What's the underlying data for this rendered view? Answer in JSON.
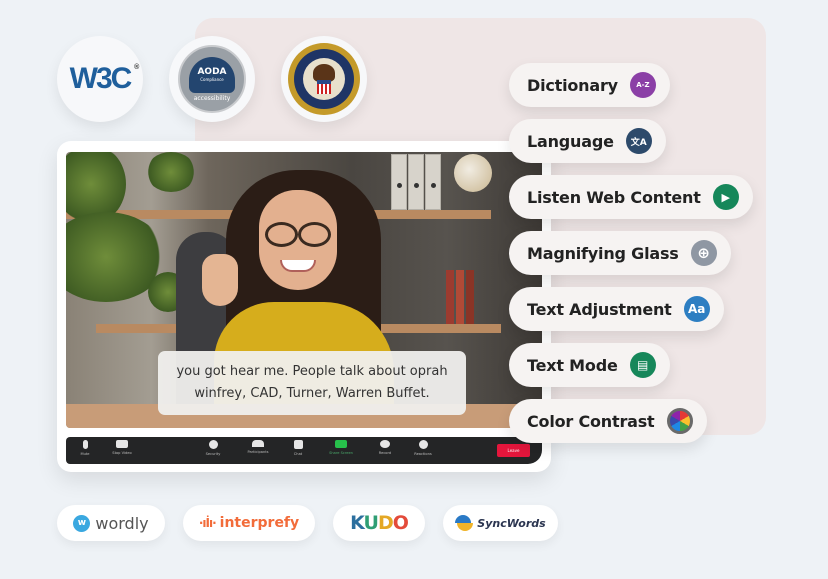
{
  "compliance_badges": [
    {
      "name": "W3C",
      "text": "W3C",
      "mark": "®"
    },
    {
      "name": "AODA",
      "text": "AODA",
      "subtext": "Compliance",
      "bottom": "accessibility"
    },
    {
      "name": "Department of Justice",
      "text": "Department of Justice"
    }
  ],
  "video_call": {
    "caption_line1": "you got hear me. People talk about oprah",
    "caption_line2": "winfrey, CAD, Turner, Warren Buffet.",
    "toolbar": {
      "mute": "Mute",
      "stop_video": "Stop Video",
      "security": "Security",
      "participants": "Participants",
      "chat": "Chat",
      "share_screen": "Share Screen",
      "record": "Record",
      "reactions": "Reactions",
      "leave": "Leave"
    }
  },
  "features": [
    {
      "label": "Dictionary",
      "icon": "book-az-icon",
      "glyph": "A-Z",
      "color": "#8b3fa6"
    },
    {
      "label": "Language",
      "icon": "translate-icon",
      "glyph": "文A",
      "color": "#2d4a6b"
    },
    {
      "label": "Listen Web Content",
      "icon": "play-icon",
      "glyph": "▶",
      "color": "#16875a"
    },
    {
      "label": "Magnifying Glass",
      "icon": "magnifier-icon",
      "glyph": "⊕",
      "color": "#8f97a3"
    },
    {
      "label": "Text Adjustment",
      "icon": "text-size-icon",
      "glyph": "Aa",
      "color": "#2d7ec2"
    },
    {
      "label": "Text Mode",
      "icon": "text-document-icon",
      "glyph": "▤",
      "color": "#16875a"
    },
    {
      "label": "Color Contrast",
      "icon": "color-wheel-icon",
      "glyph": "",
      "color": "#6a6a6a"
    }
  ],
  "partners": {
    "wordly": {
      "badge": "w",
      "text": "wordly"
    },
    "interprefy": {
      "bars": "·ıİı·",
      "text": "interprefy"
    },
    "kudo": {
      "letters": [
        "K",
        "U",
        "D",
        "O"
      ]
    },
    "syncwords": {
      "text": "SyncWords"
    }
  }
}
